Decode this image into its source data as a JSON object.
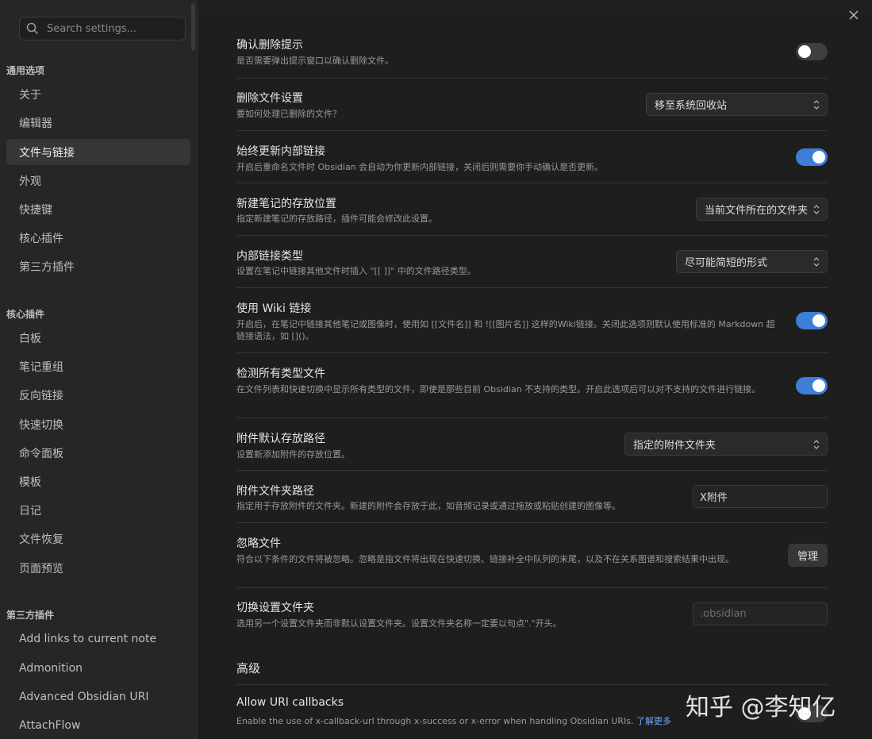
{
  "search": {
    "placeholder": "Search settings..."
  },
  "sidebar": {
    "groups": [
      {
        "title": "通用选项",
        "items": [
          "关于",
          "编辑器",
          "文件与链接",
          "外观",
          "快捷键",
          "核心插件",
          "第三方插件"
        ]
      },
      {
        "title": "核心插件",
        "items": [
          "白板",
          "笔记重组",
          "反向链接",
          "快速切换",
          "命令面板",
          "模板",
          "日记",
          "文件恢复",
          "页面预览"
        ]
      },
      {
        "title": "第三方插件",
        "items": [
          "Add links to current note",
          "Admonition",
          "Advanced Obsidian URI",
          "AttachFlow"
        ]
      }
    ],
    "active": "文件与链接"
  },
  "settings": [
    {
      "title": "确认删除提示",
      "desc": "是否需要弹出提示窗口以确认删除文件。",
      "control": "toggle",
      "on": false
    },
    {
      "title": "删除文件设置",
      "desc": "要如何处理已删除的文件？",
      "control": "dropdown",
      "value": "移至系统回收站"
    },
    {
      "title": "始终更新内部链接",
      "desc": "开启后重命名文件时 Obsidian 会自动为你更新内部链接，关闭后则需要你手动确认是否更新。",
      "control": "toggle",
      "on": true
    },
    {
      "title": "新建笔记的存放位置",
      "desc": "指定新建笔记的存放路径，插件可能会修改此设置。",
      "control": "dropdown",
      "value": "当前文件所在的文件夹"
    },
    {
      "title": "内部链接类型",
      "desc": "设置在笔记中链接其他文件时插入 \"[[ ]]\" 中的文件路径类型。",
      "control": "dropdown",
      "value": "尽可能简短的形式"
    },
    {
      "title": "使用 Wiki 链接",
      "desc": "开启后，在笔记中链接其他笔记或图像时，使用如 [[文件名]] 和 ![[图片名]] 这样的Wiki链接。关闭此选项则默认使用标准的 Markdown 超链接语法，如 []()。",
      "control": "toggle",
      "on": true
    },
    {
      "title": "检测所有类型文件",
      "desc": "在文件列表和快速切换中显示所有类型的文件，即使是那些目前 Obsidian 不支持的类型。开启此选项后可以对不支持的文件进行链接。",
      "control": "toggle",
      "on": true
    },
    {
      "title": "附件默认存放路径",
      "desc": "设置新添加附件的存放位置。",
      "control": "dropdown",
      "value": "指定的附件文件夹"
    },
    {
      "title": "附件文件夹路径",
      "desc": "指定用于存放附件的文件夹。新建的附件会存放于此，如音频记录或通过拖放或粘贴创建的图像等。",
      "control": "text",
      "value": "X附件"
    },
    {
      "title": "忽略文件",
      "desc": "符合以下条件的文件将被忽略。忽略是指文件将出现在快速切换、链接补全中队列的末尾，以及不在关系图谱和搜索结果中出现。",
      "control": "button",
      "value": "管理"
    },
    {
      "title": "切换设置文件夹",
      "desc": "选用另一个设置文件夹而非默认设置文件夹。设置文件夹名称一定要以句点\".\"开头。",
      "control": "text-placeholder",
      "value": ".obsidian"
    }
  ],
  "advanced": {
    "heading": "高级",
    "uri_title": "Allow URI callbacks",
    "uri_desc": "Enable the use of x-callback-url through x-success or x-error when handling Obsidian URIs.",
    "uri_link": "了解更多"
  },
  "watermark": "知乎 @李知亿",
  "colors": {
    "accent": "#3d7fd6",
    "link": "#6ea8ff"
  }
}
